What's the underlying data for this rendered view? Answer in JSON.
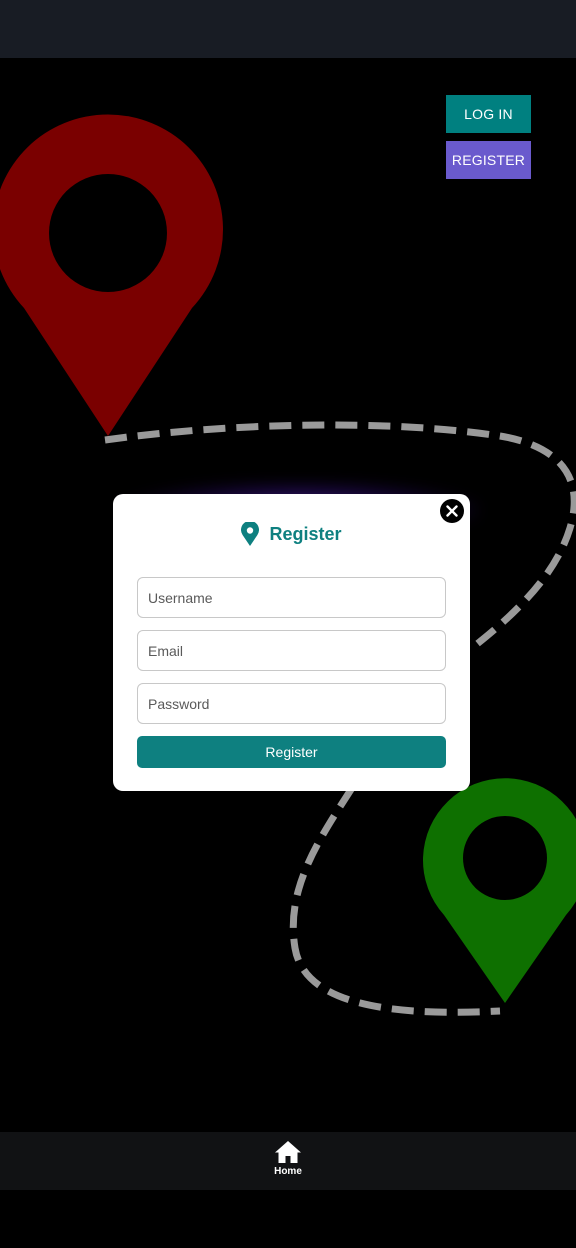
{
  "header": {
    "login_label": "LOG IN",
    "register_label": "REGISTER"
  },
  "modal": {
    "title": "Register",
    "username_placeholder": "Username",
    "email_placeholder": "Email",
    "password_placeholder": "Password",
    "submit_label": "Register"
  },
  "nav": {
    "home_label": "Home"
  },
  "icons": {
    "modal_title_icon": "map-pin-icon",
    "close": "close-icon",
    "home": "home-icon"
  },
  "colors": {
    "accent": "#008080",
    "register_button": "#6a5acd",
    "start_pin": "#7a0000",
    "end_pin": "#0e7000",
    "route": "#9a9a9a"
  }
}
